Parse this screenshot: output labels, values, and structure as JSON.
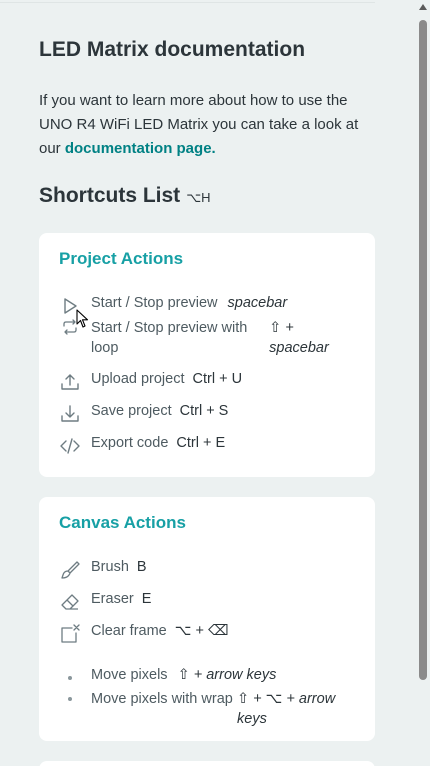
{
  "documentation": {
    "title": "LED Matrix documentation",
    "text": "If you want to learn more about how to use the UNO R4 WiFi LED Matrix you can take a look at our",
    "link": "documentation page."
  },
  "shortcuts": {
    "title": "Shortcuts List",
    "key": "⌥H"
  },
  "project_actions": {
    "title": "Project Actions",
    "items": [
      {
        "label": "Start / Stop preview",
        "key": "spacebar",
        "icon": "play-icon"
      },
      {
        "label": "Start / Stop preview with loop",
        "key": "⇧ + spacebar",
        "icon": "loop-icon"
      },
      {
        "label": "Upload project",
        "key": "Ctrl + U",
        "icon": "upload-icon"
      },
      {
        "label": "Save project",
        "key": "Ctrl + S",
        "icon": "save-icon"
      },
      {
        "label": "Export code",
        "key": "Ctrl + E",
        "icon": "code-icon"
      }
    ]
  },
  "canvas_actions": {
    "title": "Canvas Actions",
    "items": [
      {
        "label": "Brush",
        "key": "B",
        "icon": "brush-icon"
      },
      {
        "label": "Eraser",
        "key": "E",
        "icon": "eraser-icon"
      },
      {
        "label": "Clear frame",
        "key": "⌥ + ⌫",
        "icon": "clear-frame-icon"
      },
      {
        "label": "Move pixels",
        "key": "⇧ + arrow keys",
        "icon": "dot-icon"
      },
      {
        "label": "Move pixels with wrap",
        "key": "⇧ + ⌥ + arrow keys",
        "icon": "dot-icon"
      }
    ]
  },
  "colors": {
    "accent": "#17a0a5",
    "link": "#008184",
    "background": "#ecf1f1",
    "card": "#ffffff"
  }
}
